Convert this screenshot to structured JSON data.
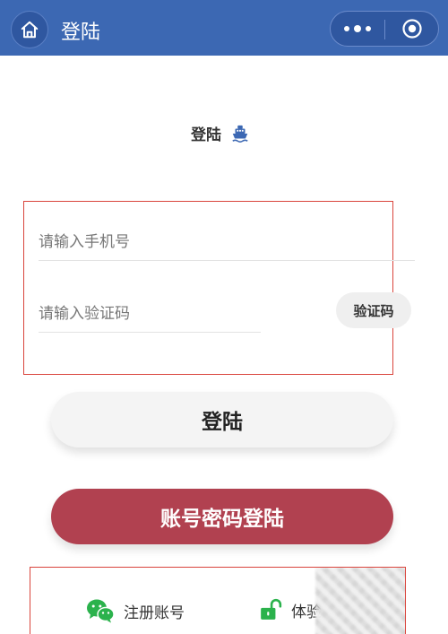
{
  "navbar": {
    "title": "登陆",
    "home_icon": "home-icon",
    "more_icon": "more-dots-icon",
    "close_icon": "target-circle-icon",
    "color": "#3c68b3"
  },
  "heading": {
    "text": "登陆",
    "icon": "ship-icon",
    "icon_color": "#3c68b3"
  },
  "form": {
    "phone_placeholder": "请输入手机号",
    "code_placeholder": "请输入验证码",
    "code_button": "验证码"
  },
  "buttons": {
    "login": "登陆",
    "password_login": "账号密码登陆",
    "password_login_color": "#b14150"
  },
  "bottom": {
    "register_label": "注册账号",
    "register_icon": "wechat-icon",
    "trial_label": "体验",
    "trial_icon": "unlock-icon",
    "icon_color": "#2bb24c"
  }
}
